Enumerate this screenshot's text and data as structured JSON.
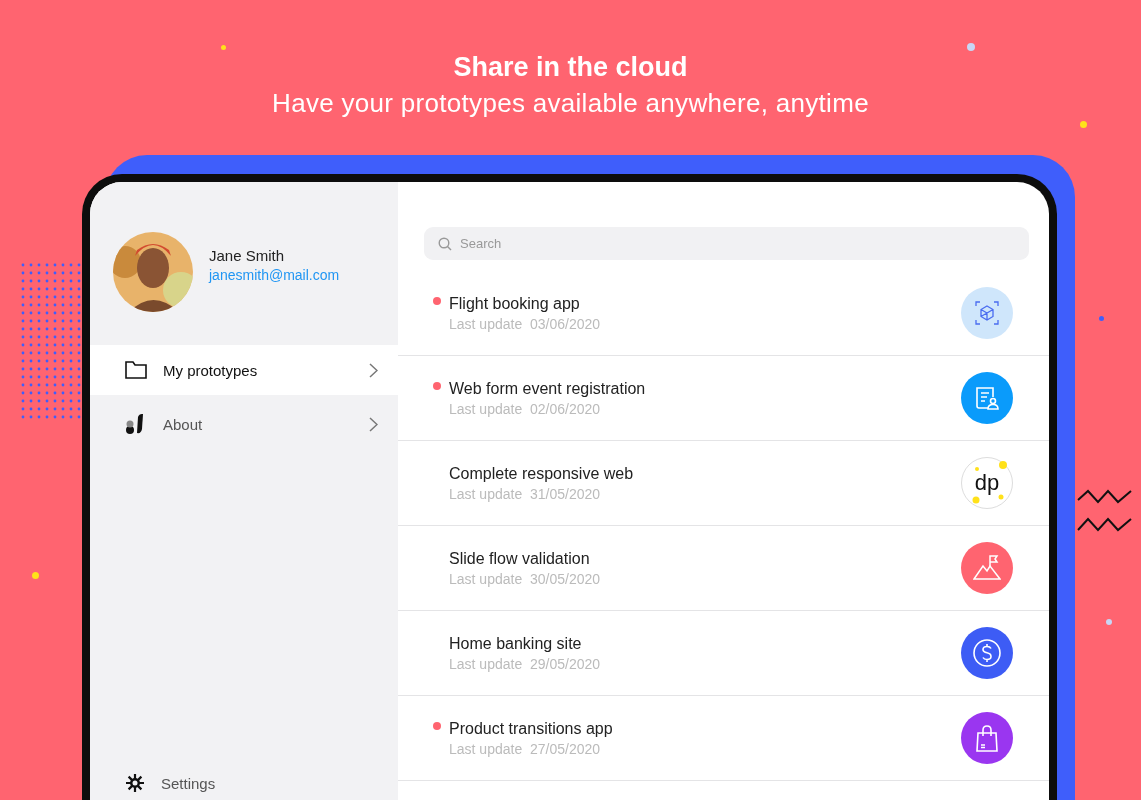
{
  "headline": {
    "title": "Share in the cloud",
    "subtitle": "Have your prototypes available anywhere, anytime"
  },
  "profile": {
    "name": "Jane Smith",
    "email": "janesmith@mail.com"
  },
  "menu": [
    {
      "label": "My prototypes",
      "kind": "folder",
      "selected": true
    },
    {
      "label": "About",
      "kind": "brand",
      "selected": false
    }
  ],
  "settings": {
    "label": "Settings"
  },
  "search": {
    "placeholder": "Search"
  },
  "prototypes": [
    {
      "title": "Flight booking app",
      "updated": "Last update  03/06/2020",
      "unread": true,
      "kind": "cube",
      "color": "#cfe6fb"
    },
    {
      "title": "Web form event registration",
      "updated": "Last update  02/06/2020",
      "unread": true,
      "kind": "form",
      "color": "#0a9bfb"
    },
    {
      "title": "Complete responsive web",
      "updated": "Last update  31/05/2020",
      "unread": false,
      "kind": "logo",
      "logo_text": "dp",
      "color": "#ffffff"
    },
    {
      "title": "Slide flow validation",
      "updated": "Last update  30/05/2020",
      "unread": false,
      "kind": "flag",
      "color": "#ff6470"
    },
    {
      "title": "Home banking site",
      "updated": "Last update  29/05/2020",
      "unread": false,
      "kind": "dollar",
      "color": "#3d5cf5"
    },
    {
      "title": "Product transitions app",
      "updated": "Last update  27/05/2020",
      "unread": true,
      "kind": "bag",
      "color": "#9a36f0"
    }
  ]
}
